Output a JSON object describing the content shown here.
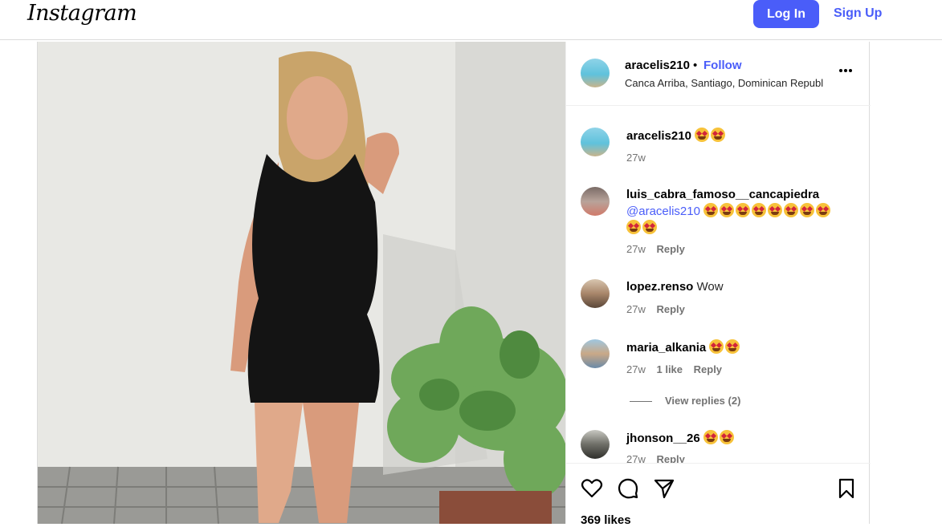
{
  "header": {
    "logo": "Instagram",
    "login_label": "Log In",
    "signup_label": "Sign Up"
  },
  "post": {
    "username": "aracelis210",
    "separator": "•",
    "follow_label": "Follow",
    "location": "Canca Arriba, Santiago, Dominican Republic",
    "likes": "369 likes"
  },
  "comments": [
    {
      "user": "aracelis210",
      "text": "",
      "emoji_count": 2,
      "time": "27w"
    },
    {
      "user": "luis_cabra_famoso__cancapiedra",
      "mention": "@aracelis210",
      "emoji_count": 10,
      "time": "27w",
      "reply": "Reply"
    },
    {
      "user": "lopez.renso",
      "text": "Wow",
      "time": "27w",
      "reply": "Reply"
    },
    {
      "user": "maria_alkania",
      "emoji_count": 2,
      "time": "27w",
      "likes": "1 like",
      "reply": "Reply",
      "view_replies": "View replies (2)"
    },
    {
      "user": "jhonson__26",
      "emoji_count": 2,
      "time": "27w",
      "reply": "Reply"
    }
  ],
  "icons": [
    "more-options-icon",
    "heart-icon",
    "comment-icon",
    "share-icon",
    "bookmark-icon",
    "heart-eyes-emoji"
  ],
  "colors": {
    "accent": "#4a5df9",
    "border": "#dbdbdb",
    "muted": "#737373"
  }
}
